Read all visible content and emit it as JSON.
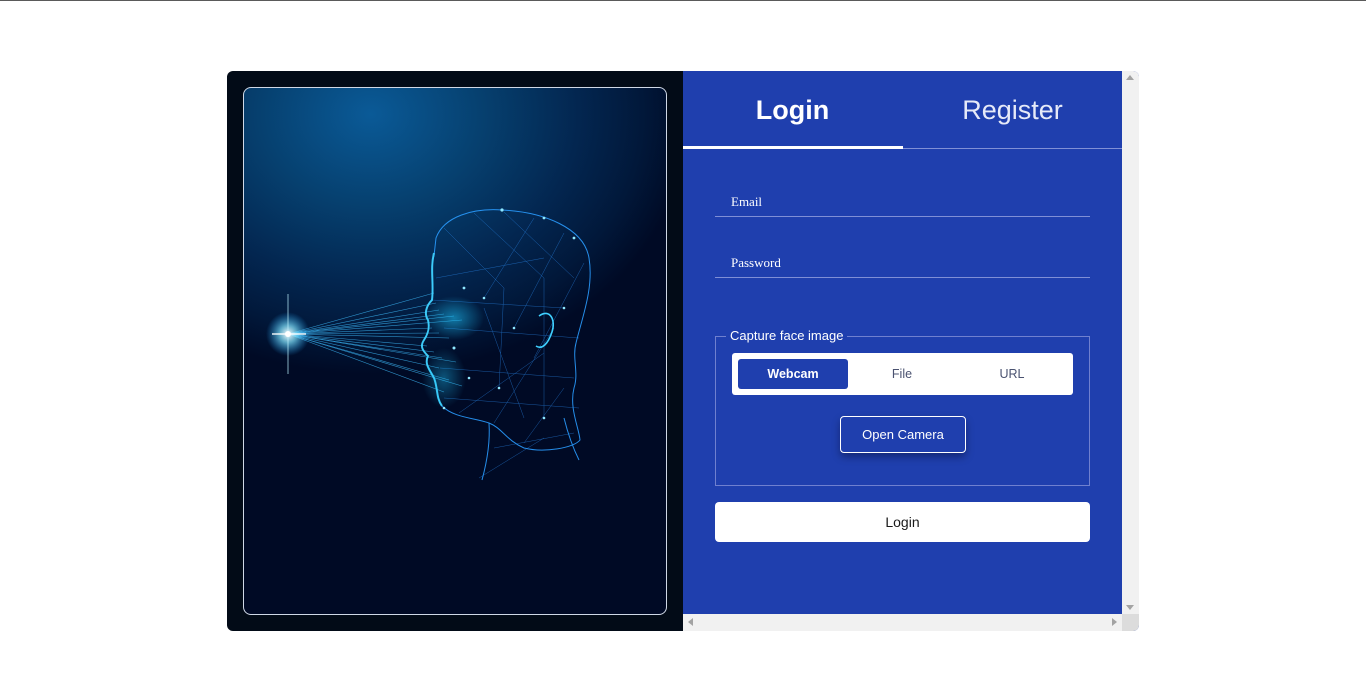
{
  "colors": {
    "panel_blue": "#1f3fae",
    "dark_bg": "#020b17",
    "accent_white": "#ffffff"
  },
  "illustration": {
    "icon": "face-scan-wireframe-icon"
  },
  "tabs": [
    {
      "label": "Login",
      "active": true
    },
    {
      "label": "Register",
      "active": false
    }
  ],
  "form": {
    "email_placeholder": "Email",
    "email_value": "",
    "password_placeholder": "Password",
    "password_value": ""
  },
  "capture": {
    "legend": "Capture face image",
    "options": [
      "Webcam",
      "File",
      "URL"
    ],
    "selected": "Webcam",
    "open_camera_label": "Open Camera"
  },
  "submit_label": "Login"
}
